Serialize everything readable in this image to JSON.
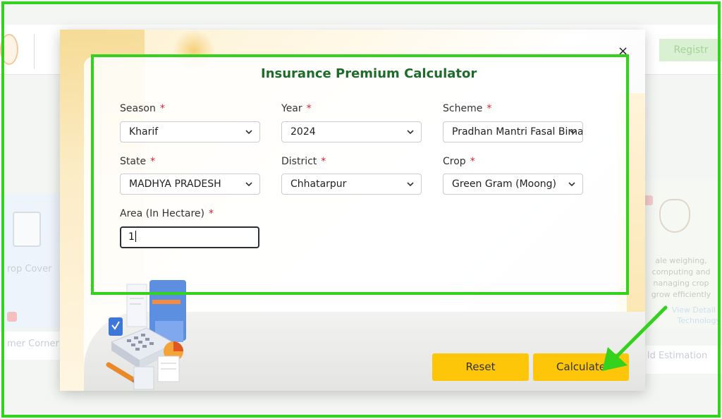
{
  "background": {
    "register_label": "Registr",
    "left_card_text": "rop Cover",
    "left_card_bottom_text": "mer Corner",
    "right_card_text": "ale weighing, computing and nanaging crop grow efficiently",
    "right_card_link": "View Detail / Technology",
    "right_card_bottom_text": "ld Estimation"
  },
  "modal": {
    "title": "Insurance Premium Calculator",
    "close_glyph": "×",
    "fields": {
      "season": {
        "label": "Season",
        "required": "*",
        "value": "Kharif"
      },
      "year": {
        "label": "Year",
        "required": "*",
        "value": "2024"
      },
      "scheme": {
        "label": "Scheme",
        "required": "*",
        "value": "Pradhan Mantri Fasal Bima"
      },
      "state": {
        "label": "State",
        "required": "*",
        "value": "MADHYA PRADESH"
      },
      "district": {
        "label": "District",
        "required": "*",
        "value": "Chhatarpur"
      },
      "crop": {
        "label": "Crop",
        "required": "*",
        "value": "Green Gram (Moong)"
      },
      "area": {
        "label": "Area (In Hectare)",
        "required": "*",
        "value": "1"
      }
    },
    "buttons": {
      "reset_label": "Reset",
      "calculate_label": "Calculate"
    }
  },
  "colors": {
    "accent_button": "#fdc608",
    "title_green": "#1e6b2b",
    "annotation_green": "#33d21d",
    "required_red": "#d9232d"
  }
}
